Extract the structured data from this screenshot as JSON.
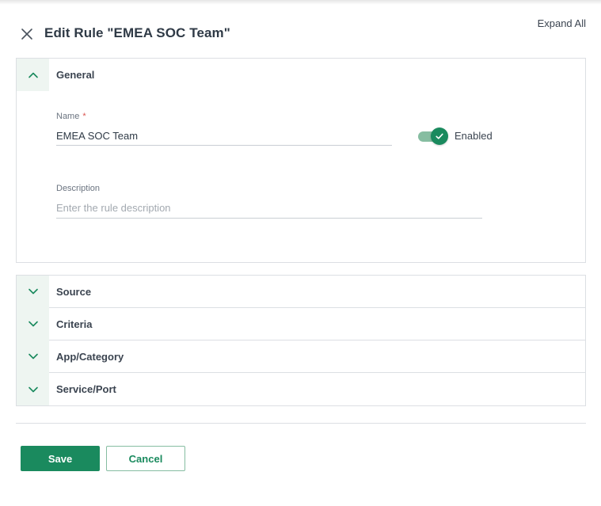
{
  "header": {
    "title": "Edit Rule \"EMEA SOC Team\"",
    "expand_all": "Expand All"
  },
  "general": {
    "section_title": "General",
    "name_label": "Name",
    "required_mark": "*",
    "name_value": "EMEA SOC Team",
    "enabled": true,
    "toggle_label": "Enabled",
    "description_label": "Description",
    "description_value": "",
    "description_placeholder": "Enter the rule description"
  },
  "sections": [
    {
      "title": "Source"
    },
    {
      "title": "Criteria"
    },
    {
      "title": "App/Category"
    },
    {
      "title": "Service/Port"
    }
  ],
  "footer": {
    "save_label": "Save",
    "cancel_label": "Cancel"
  },
  "colors": {
    "accent": "#1a8a5e",
    "accent_light": "#86bda1",
    "header_tint": "#eef5f1",
    "border": "#dcdfe3"
  },
  "icons": {
    "close": "close-icon",
    "chevron_up": "chevron-up-icon",
    "chevron_down": "chevron-down-icon",
    "check": "check-icon"
  }
}
